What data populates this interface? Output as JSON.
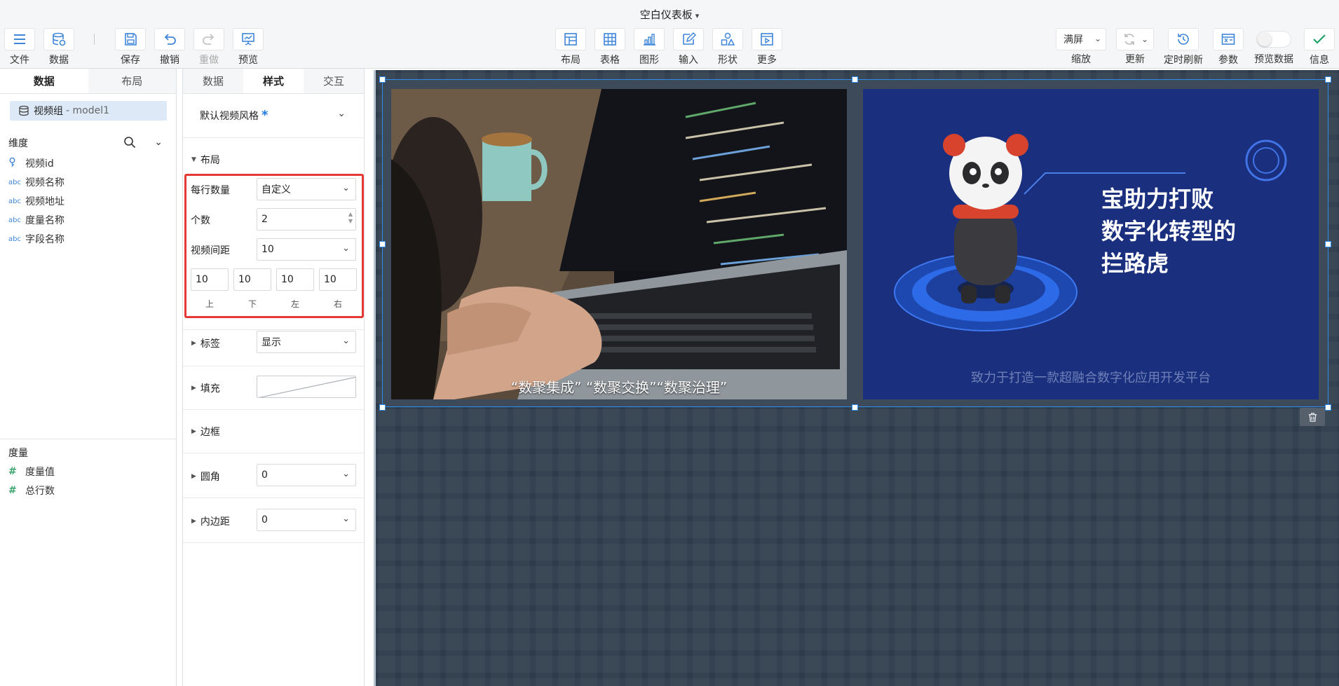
{
  "header": {
    "title": "空白仪表板",
    "left_tools": [
      {
        "label": "文件",
        "icon": "menu-icon"
      },
      {
        "label": "数据",
        "icon": "database-icon"
      },
      {
        "label": "保存",
        "icon": "save-icon"
      },
      {
        "label": "撤销",
        "icon": "undo-icon"
      },
      {
        "label": "重做",
        "icon": "redo-icon",
        "disabled": true
      },
      {
        "label": "预览",
        "icon": "preview-icon"
      }
    ],
    "center_tools": [
      {
        "label": "布局",
        "icon": "layout-icon"
      },
      {
        "label": "表格",
        "icon": "table-icon"
      },
      {
        "label": "图形",
        "icon": "chart-icon"
      },
      {
        "label": "输入",
        "icon": "input-icon"
      },
      {
        "label": "形状",
        "icon": "shape-icon"
      },
      {
        "label": "更多",
        "icon": "more-icon"
      }
    ],
    "zoom": {
      "value": "满屏",
      "label": "缩放"
    },
    "refresh_label": "更新",
    "right_tools": [
      {
        "label": "定时刷新",
        "icon": "timed-refresh-icon"
      },
      {
        "label": "参数",
        "icon": "parameter-icon"
      }
    ],
    "preview_data_label": "预览数据",
    "preview_data_on": false,
    "info_label": "信息"
  },
  "left_panel": {
    "tabs": [
      "数据",
      "布局"
    ],
    "active_tab": "数据",
    "model": {
      "name": "视频组",
      "suffix": "- model1"
    },
    "dimension_title": "维度",
    "dimensions": [
      {
        "type": "key",
        "name": "视频id"
      },
      {
        "type": "abc",
        "name": "视频名称"
      },
      {
        "type": "abc",
        "name": "视频地址"
      },
      {
        "type": "abc",
        "name": "度量名称"
      },
      {
        "type": "abc",
        "name": "字段名称"
      }
    ],
    "measure_title": "度量",
    "measures": [
      {
        "type": "#",
        "name": "度量值"
      },
      {
        "type": "#",
        "name": "总行数"
      }
    ]
  },
  "style_panel": {
    "tabs": [
      "数据",
      "样式",
      "交互"
    ],
    "active_tab": "样式",
    "theme": {
      "label": "默认视频风格",
      "modified_mark": "*"
    },
    "layout_section": "布局",
    "per_row": {
      "label": "每行数量",
      "value": "自定义"
    },
    "count": {
      "label": "个数",
      "value": "2"
    },
    "spacing": {
      "label": "视频间距",
      "value": "10"
    },
    "margins": [
      {
        "label": "上",
        "value": "10"
      },
      {
        "label": "下",
        "value": "10"
      },
      {
        "label": "左",
        "value": "10"
      },
      {
        "label": "右",
        "value": "10"
      }
    ],
    "label_section": {
      "title": "标签",
      "value": "显示"
    },
    "fill_section": {
      "title": "填充"
    },
    "border_section": {
      "title": "边框"
    },
    "radius_section": {
      "title": "圆角",
      "value": "0"
    },
    "padding_section": {
      "title": "内边距",
      "value": "0"
    }
  },
  "canvas": {
    "video1": {
      "subtitle": "“数聚集成” “数聚交换”“数聚治理”"
    },
    "video2": {
      "slogan_lines": [
        "宝助力打败",
        "数字化转型的",
        "拦路虎"
      ],
      "tagline": "致力于打造一款超融合数字化应用开发平台"
    },
    "accent_color": "#2f8cf0",
    "background_color": "#2d3b4b"
  }
}
